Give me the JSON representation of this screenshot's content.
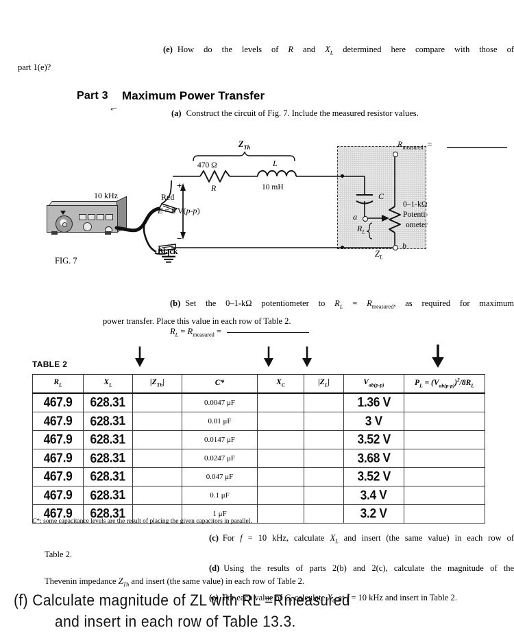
{
  "top_question": {
    "label": "(e)",
    "line1": "How do the levels of R and XL determined here compare with those of",
    "line2": "part 1(e)?"
  },
  "part3": {
    "number": "Part 3",
    "title": "Maximum Power Transfer",
    "hand_mark": "←",
    "item_a_label": "(a)",
    "item_a_text": "Construct the circuit of Fig. 7. Include the measured resistor values."
  },
  "figure": {
    "caption": "FIG. 7",
    "frequency": "10 kHz",
    "source_label": "E = 8 V(p-p)",
    "red_lead": "Red",
    "black_lead": "Black",
    "zth_label": "ZTh",
    "resistor_value": "470 Ω",
    "resistor_symbol": "R",
    "inductor_symbol": "L",
    "inductor_value": "10 mH",
    "cap_symbol": "C",
    "pot_rating": "0–1-kΩ",
    "pot_label_line1": "Potenti-",
    "pot_label_line2": "ometer",
    "rl_symbol": "RL",
    "node_a": "a",
    "node_b": "b",
    "zl_label": "ZL",
    "rmeasured_label": "Rmeasured  =",
    "plus": "+",
    "minus": "−"
  },
  "part_b": {
    "label": "(b)",
    "line1": "Set the 0–1-kΩ potentiometer to RL = Rmeasured, as required for maximum",
    "line2": "power transfer. Place this value in each row of Table 2.",
    "rl_equation": "RL = Rmeasured ="
  },
  "table2": {
    "caption": "TABLE 2",
    "arrow_glyph": "↓",
    "arrow_columns": [
      "|ZTh|",
      "XC",
      "|ZL|",
      "PL"
    ],
    "headers": [
      "RL",
      "XL",
      "|ZTh|",
      "C*",
      "XC",
      "|ZL|",
      "Vab(p-p)",
      "PL = (Vab(p-p))2/8RL"
    ],
    "rows": [
      {
        "RL": "467.9",
        "XL": "628.31",
        "ZTh": "",
        "C": "0.0047 μF",
        "XC": "",
        "ZL": "",
        "Vab": "1.36 V",
        "PL": ""
      },
      {
        "RL": "467.9",
        "XL": "628.31",
        "ZTh": "",
        "C": "0.01 μF",
        "XC": "",
        "ZL": "",
        "Vab": "3 V",
        "PL": ""
      },
      {
        "RL": "467.9",
        "XL": "628.31",
        "ZTh": "",
        "C": "0.0147 μF",
        "XC": "",
        "ZL": "",
        "Vab": "3.52 V",
        "PL": ""
      },
      {
        "RL": "467.9",
        "XL": "628.31",
        "ZTh": "",
        "C": "0.0247 μF",
        "XC": "",
        "ZL": "",
        "Vab": "3.68 V",
        "PL": ""
      },
      {
        "RL": "467.9",
        "XL": "628.31",
        "ZTh": "",
        "C": "0.047 μF",
        "XC": "",
        "ZL": "",
        "Vab": "3.52 V",
        "PL": ""
      },
      {
        "RL": "467.9",
        "XL": "628.31",
        "ZTh": "",
        "C": "0.1 μF",
        "XC": "",
        "ZL": "",
        "Vab": "3.4 V",
        "PL": ""
      },
      {
        "RL": "467.9",
        "XL": "628.31",
        "ZTh": "",
        "C": "1 μF",
        "XC": "",
        "ZL": "",
        "Vab": "3.2 V",
        "PL": ""
      }
    ],
    "footnote": "C*: some capacitance levels are the result of placing the given capacitors in parallel."
  },
  "parts_cde": {
    "c_label": "(c)",
    "c_line1": "For f = 10 kHz, calculate XL and insert (the same value) in each row of",
    "c_line2": "Table 2.",
    "d_label": "(d)",
    "d_line1": "Using the results of parts 2(b) and 2(c), calculate the magnitude of the",
    "d_line2": "Thevenin impedance ZTh and insert (the same value) in each row of Table 2.",
    "e_label": "(e)",
    "e_line1": "For each value of C, calculate XC at f = 10 kHz and insert in Table 2."
  },
  "hand_note": {
    "line1": "(f) Calculate  magnitude of ZL with RL =Rmeasured",
    "line2": "and insert in each row of Table 13.3."
  },
  "colors": {
    "ink": "#111111",
    "paper": "#ffffff",
    "shade": "#e9e9e9"
  }
}
